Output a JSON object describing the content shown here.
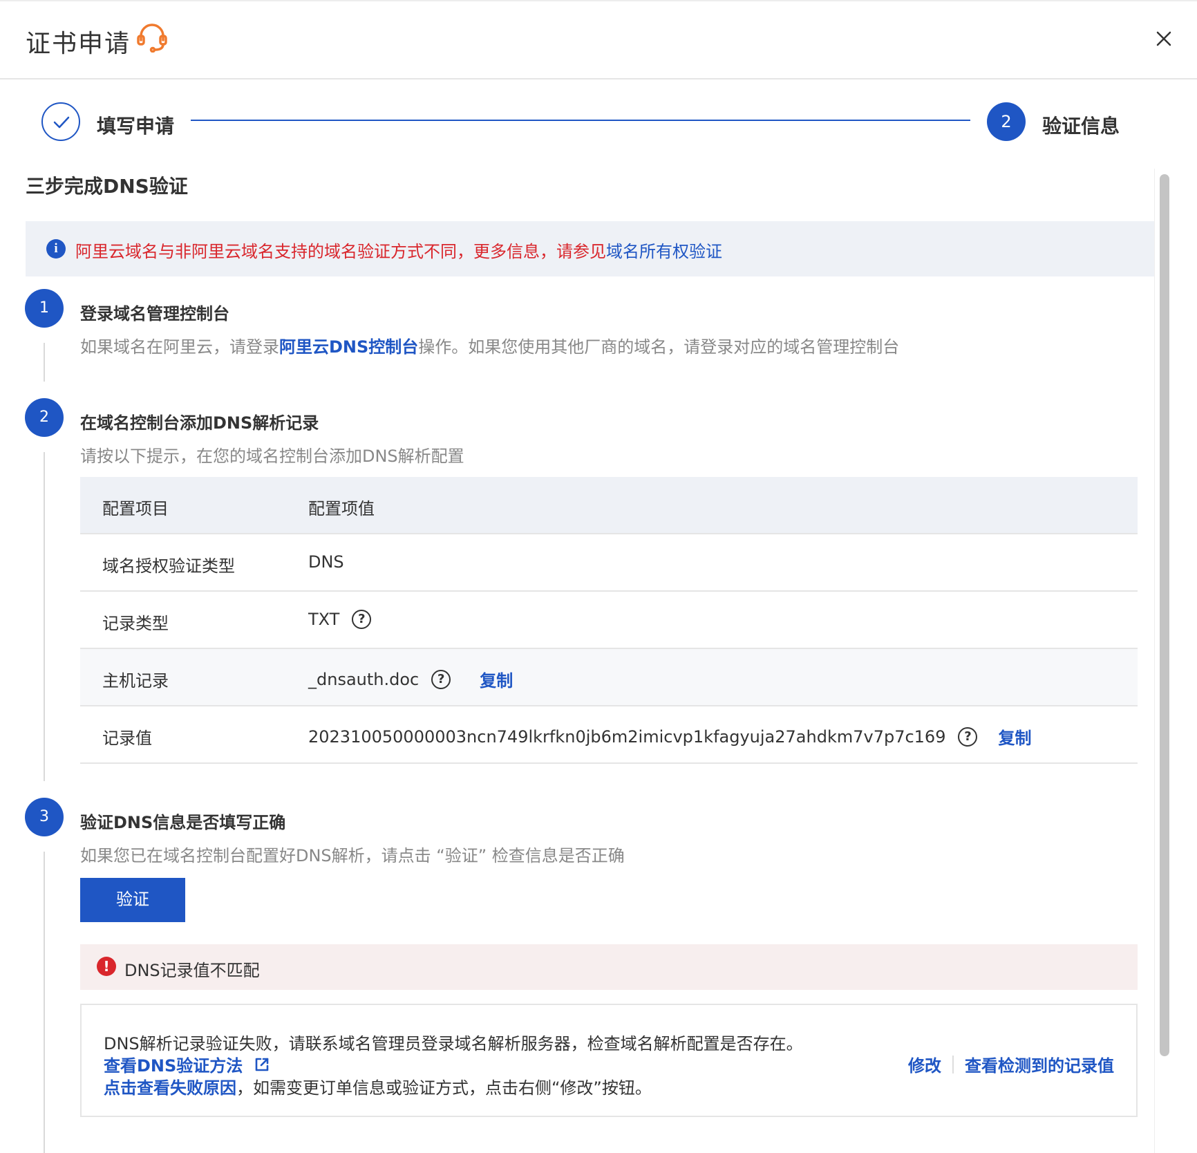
{
  "header": {
    "title": "证书申请"
  },
  "steps": {
    "step1_label": "填写申请",
    "step2_number": "2",
    "step2_label": "验证信息"
  },
  "content": {
    "section_title": "三步完成DNS验证",
    "notice": {
      "text": "阿里云域名与非阿里云域名支持的域名验证方式不同，更多信息，请参见",
      "link": "域名所有权验证"
    },
    "step1": {
      "number": "1",
      "title": "登录域名管理控制台",
      "desc_before": "如果域名在阿里云，请登录",
      "desc_link": "阿里云DNS控制台",
      "desc_after": "操作。如果您使用其他厂商的域名，请登录对应的域名管理控制台"
    },
    "step2": {
      "number": "2",
      "title": "在域名控制台添加DNS解析记录",
      "desc": "请按以下提示，在您的域名控制台添加DNS解析配置"
    },
    "table": {
      "headers": [
        "配置项目",
        "配置项值"
      ],
      "rows": [
        {
          "label": "域名授权验证类型",
          "value": "DNS"
        },
        {
          "label": "记录类型",
          "value": "TXT"
        },
        {
          "label": "主机记录",
          "value": "_dnsauth.doc",
          "action": "复制"
        },
        {
          "label": "记录值",
          "value": "202310050000003ncn749lkrfkn0jb6m2imicvp1kfagyuja27ahdkm7v7p7c169",
          "action": "复制"
        }
      ]
    },
    "step3": {
      "number": "3",
      "title": "验证DNS信息是否填写正确",
      "desc": "如果您已在域名控制台配置好DNS解析，请点击 “验证” 检查信息是否正确",
      "button": "验证"
    },
    "error": {
      "message": "DNS记录值不匹配"
    },
    "detail": {
      "line1": "DNS解析记录验证失败，请联系域名管理员登录域名解析服务器，检查域名解析配置是否存在。",
      "line2_link": "查看DNS验证方法",
      "line3_link": "点击查看失败原因",
      "line3_text": "，如需变更订单信息或验证方式，点击右侧“修改”按钮。",
      "action_modify": "修改",
      "action_view": "查看检测到的记录值"
    }
  },
  "colors": {
    "primary": "#1f56c4",
    "error": "#d9262c",
    "accent_orange": "#f07a2e"
  }
}
